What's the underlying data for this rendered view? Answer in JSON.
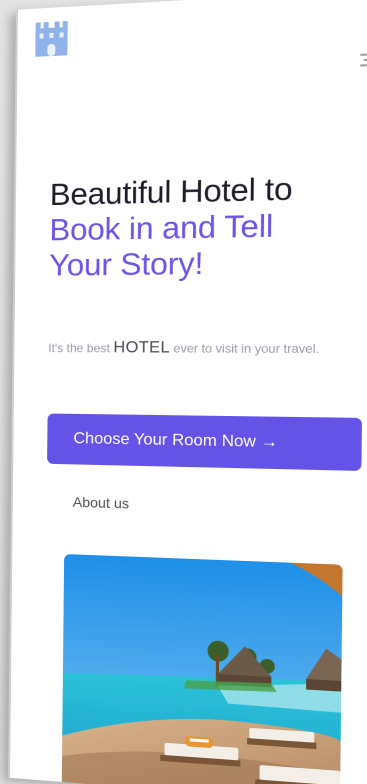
{
  "header": {
    "logo_icon": "castle-icon",
    "menu_icon": "hamburger-menu-icon"
  },
  "hero": {
    "title_line1": "Beautiful Hotel to",
    "title_line2": "Book in and Tell",
    "title_line3": "Your Story!",
    "subtitle_pre": "It's the best",
    "subtitle_highlight": "HOTEL",
    "subtitle_post": "ever to visit in your travel.",
    "cta_label": "Choose Your Room Now →",
    "about_label": "About us",
    "image_icon": "beach-resort-image"
  },
  "colors": {
    "accent": "#6552e6",
    "title_dark": "#1e1e2a",
    "muted_text": "#9a9aa6"
  }
}
